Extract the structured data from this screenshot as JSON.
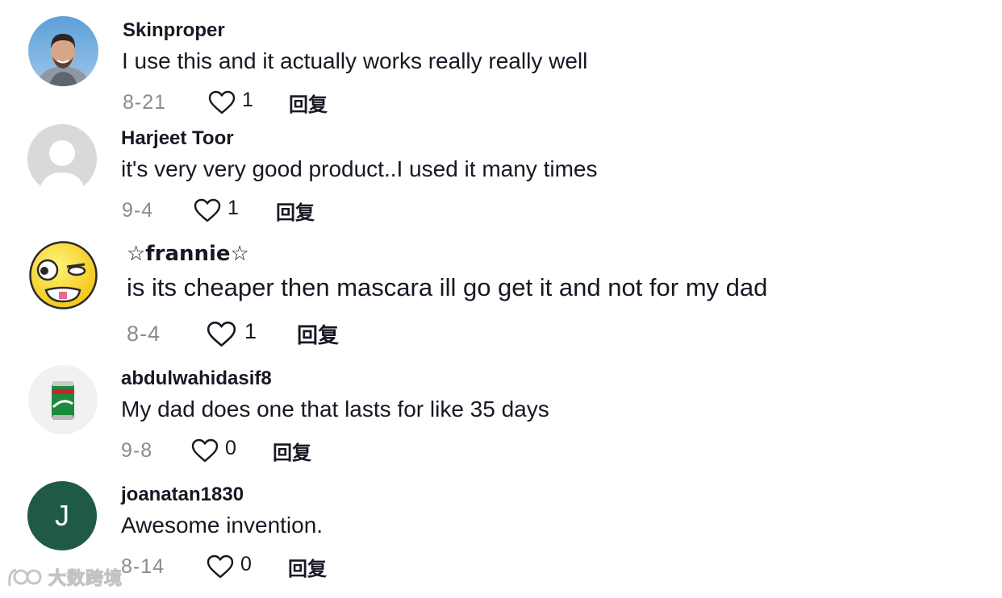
{
  "reply_label": "回复",
  "comments": [
    {
      "username": "Skinproper",
      "text": "I use this and it actually works really really well",
      "date": "8-21",
      "likes": "1",
      "avatar": "person-photo"
    },
    {
      "username": "Harjeet Toor",
      "text": "it's very very good product..I used it many times",
      "date": "9-4",
      "likes": "1",
      "avatar": "default-avatar"
    },
    {
      "username": "☆frannie☆",
      "text": "is its cheaper then mascara ill go get it and not for my dad",
      "date": "8-4",
      "likes": "1",
      "avatar": "emoji-face"
    },
    {
      "username": "abdulwahidasif8",
      "text": "My dad does one that lasts for like 35 days",
      "date": "9-8",
      "likes": "0",
      "avatar": "sprite-can"
    },
    {
      "username": "joanatan1830",
      "text": "Awesome invention.",
      "date": "8-14",
      "likes": "0",
      "avatar": "letter-avatar",
      "avatar_letter": "J",
      "avatar_color": "#1f5a46"
    }
  ],
  "watermark": {
    "text": "大数跨境",
    "logo": "kuajing-logo-icon"
  }
}
